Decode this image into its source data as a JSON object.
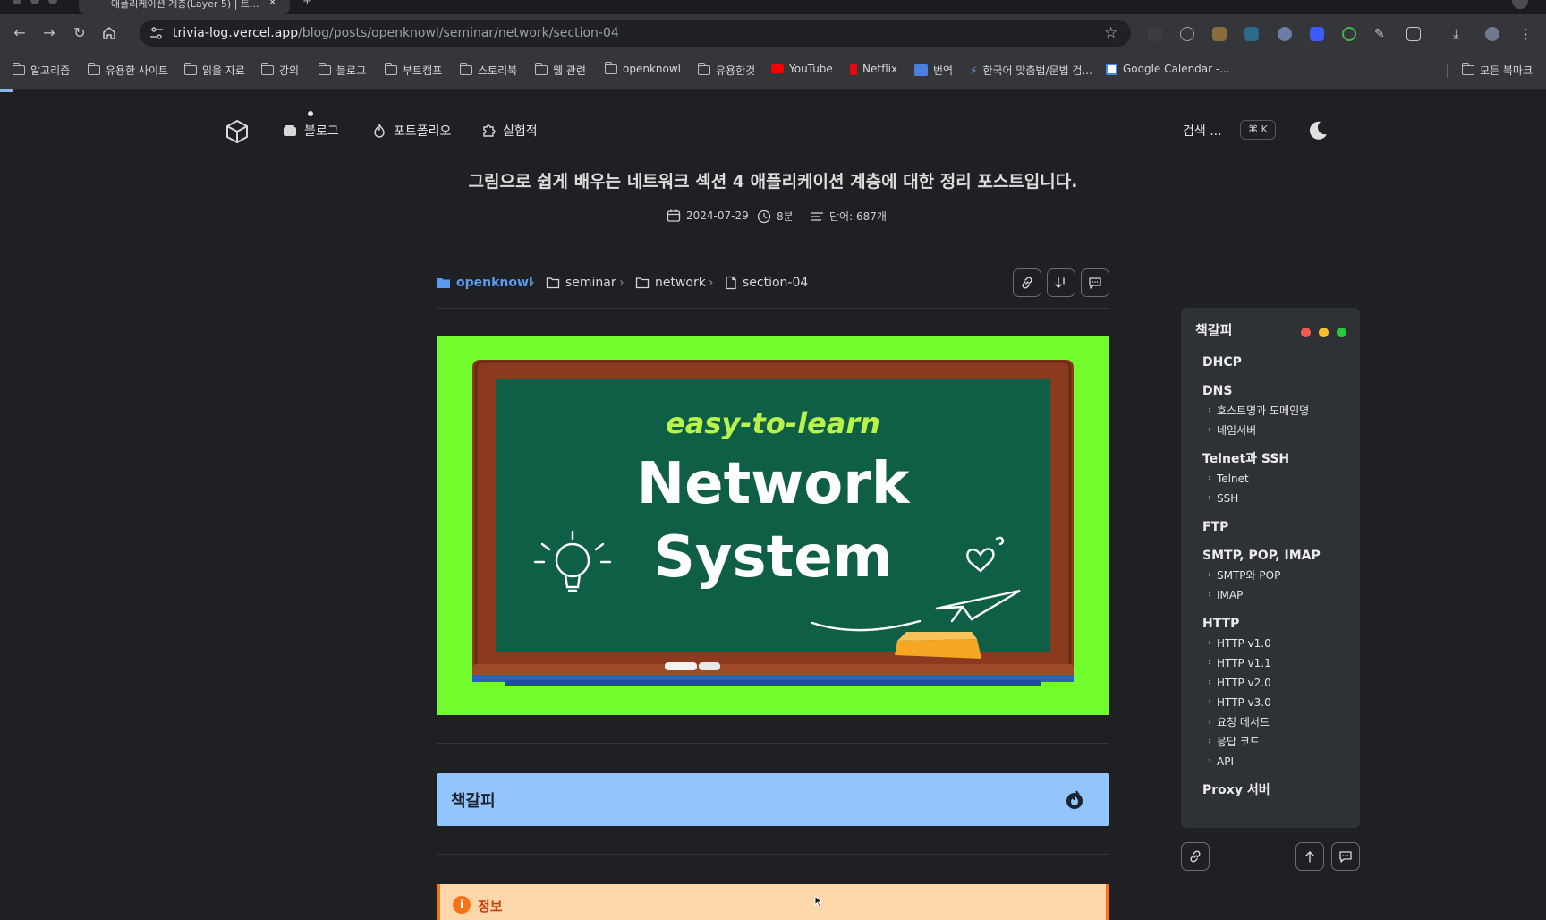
{
  "browser": {
    "tab_title": "애플리케이션 계층(Layer 5) | 트...",
    "url_domain": "trivia-log.vercel.app",
    "url_path": "/blog/posts/openknowl/seminar/network/section-04",
    "bookmarks": [
      {
        "label": "알고리즘",
        "icon": "folder-icon"
      },
      {
        "label": "유용한 사이트",
        "icon": "folder-icon"
      },
      {
        "label": "읽을 자료",
        "icon": "folder-icon"
      },
      {
        "label": "강의",
        "icon": "folder-icon"
      },
      {
        "label": "블로그",
        "icon": "folder-icon"
      },
      {
        "label": "부트캠프",
        "icon": "folder-icon"
      },
      {
        "label": "스토리북",
        "icon": "folder-icon"
      },
      {
        "label": "웹 관련",
        "icon": "folder-icon"
      },
      {
        "label": "openknowl",
        "icon": "folder-icon"
      },
      {
        "label": "유용한것",
        "icon": "folder-icon"
      },
      {
        "label": "YouTube",
        "icon": "youtube-icon"
      },
      {
        "label": "Netflix",
        "icon": "netflix-icon"
      },
      {
        "label": "번역",
        "icon": "translate-icon"
      },
      {
        "label": "한국어 맞춤법/문법 검...",
        "icon": "spellcheck-icon"
      },
      {
        "label": "Google Calendar -...",
        "icon": "calendar-icon"
      }
    ],
    "all_bookmarks_label": "모든 북마크"
  },
  "nav": {
    "blog": "블로그",
    "portfolio": "포트폴리오",
    "lab": "실험적",
    "search": "검색 ...",
    "shortcut": "⌘ K"
  },
  "post": {
    "title": "그림으로 쉽게 배우는 네트워크 섹션 4 애플리케이션 계층에 대한 정리 포스트입니다.",
    "date": "2024-07-29",
    "read_time": "8분",
    "word_count": "단어: 687개",
    "hero_line1": "easy-to-learn",
    "hero_line2": "Network",
    "hero_line3": "System"
  },
  "breadcrumb": [
    "openknowl",
    "seminar",
    "network",
    "section-04"
  ],
  "bookmark_box": {
    "title": "책갈피"
  },
  "info_box": {
    "title": "정보"
  },
  "toc": {
    "title": "책갈피",
    "sections": [
      {
        "label": "DHCP",
        "items": []
      },
      {
        "label": "DNS",
        "items": [
          "호스트명과 도메인명",
          "네임서버"
        ]
      },
      {
        "label": "Telnet과 SSH",
        "items": [
          "Telnet",
          "SSH"
        ]
      },
      {
        "label": "FTP",
        "items": []
      },
      {
        "label": "SMTP, POP, IMAP",
        "items": [
          "SMTP와 POP",
          "IMAP"
        ]
      },
      {
        "label": "HTTP",
        "items": [
          "HTTP v1.0",
          "HTTP v1.1",
          "HTTP v2.0",
          "HTTP v3.0",
          "요청 메서드",
          "응답 코드",
          "API"
        ]
      },
      {
        "label": "Proxy 서버",
        "items": []
      }
    ]
  },
  "colors": {
    "page_bg": "#1e2024",
    "accent_link": "#5b9bf0",
    "hero_bg": "#72fb2d",
    "chalkboard": "#0f5f46",
    "bookmark_box_bg": "#93c5fd",
    "info_box_bg": "#fed7aa",
    "info_accent": "#f97316"
  }
}
